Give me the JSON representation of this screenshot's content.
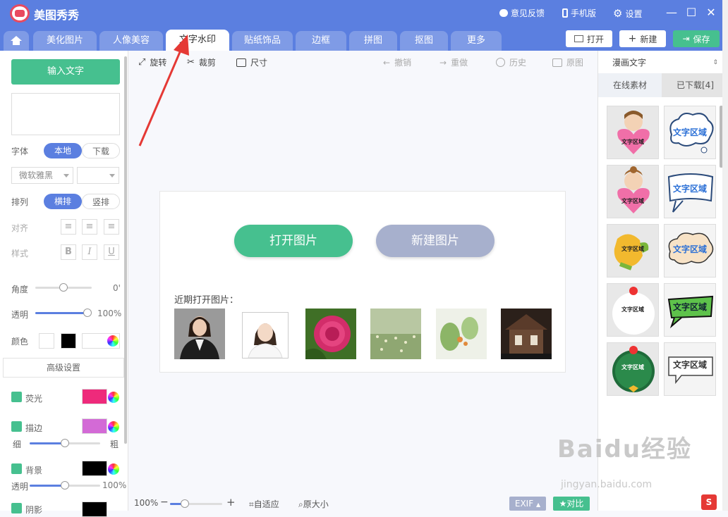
{
  "app": {
    "title": "美图秀秀"
  },
  "topbar": {
    "feedback": "意见反馈",
    "mobile": "手机版",
    "settings": "设置"
  },
  "tabs": [
    "美化图片",
    "人像美容",
    "文字水印",
    "贴纸饰品",
    "边框",
    "拼图",
    "抠图",
    "更多"
  ],
  "active_tab": "文字水印",
  "actions": {
    "open": "打开",
    "new": "新建",
    "save": "保存"
  },
  "left": {
    "input_text": "输入文字",
    "font_label": "字体",
    "font_local": "本地",
    "font_download": "下载",
    "font_name": "微软雅黑",
    "arrange_label": "排列",
    "arrange_h": "横排",
    "arrange_v": "竖排",
    "align_label": "对齐",
    "style_label": "样式",
    "bold": "B",
    "italic": "I",
    "underline": "U",
    "angle_label": "角度",
    "angle_value": "0'",
    "opacity_label": "透明",
    "opacity_value": "100%",
    "color_label": "颜色",
    "advanced": "高级设置",
    "glow_label": "荧光",
    "stroke_label": "描边",
    "thin": "细",
    "thick": "粗",
    "bg_label": "背景",
    "bg_opacity_label": "透明",
    "bg_opacity_value": "100%",
    "shadow_label": "阴影"
  },
  "toolbar": {
    "rotate": "旋转",
    "crop": "裁剪",
    "size": "尺寸",
    "undo": "撤销",
    "redo": "重做",
    "history": "历史",
    "original": "原图"
  },
  "canvas": {
    "open_image": "打开图片",
    "new_image": "新建图片",
    "recent_label": "近期打开图片："
  },
  "bottom": {
    "zoom": "100%",
    "fit": "自适应",
    "original_size": "原大小",
    "exif": "EXIF",
    "compare": "对比"
  },
  "right": {
    "category": "漫画文字",
    "tab_online": "在线素材",
    "tab_downloaded": "已下载[4]",
    "material_text": "文字区域"
  },
  "watermark": {
    "brand": "Baidu经验",
    "url": "jingyan.baidu.com"
  },
  "colors": {
    "accent": "#5b7fe0",
    "green": "#46c08f",
    "glow": "#ee2a7b",
    "stroke": "#d36ad6"
  }
}
